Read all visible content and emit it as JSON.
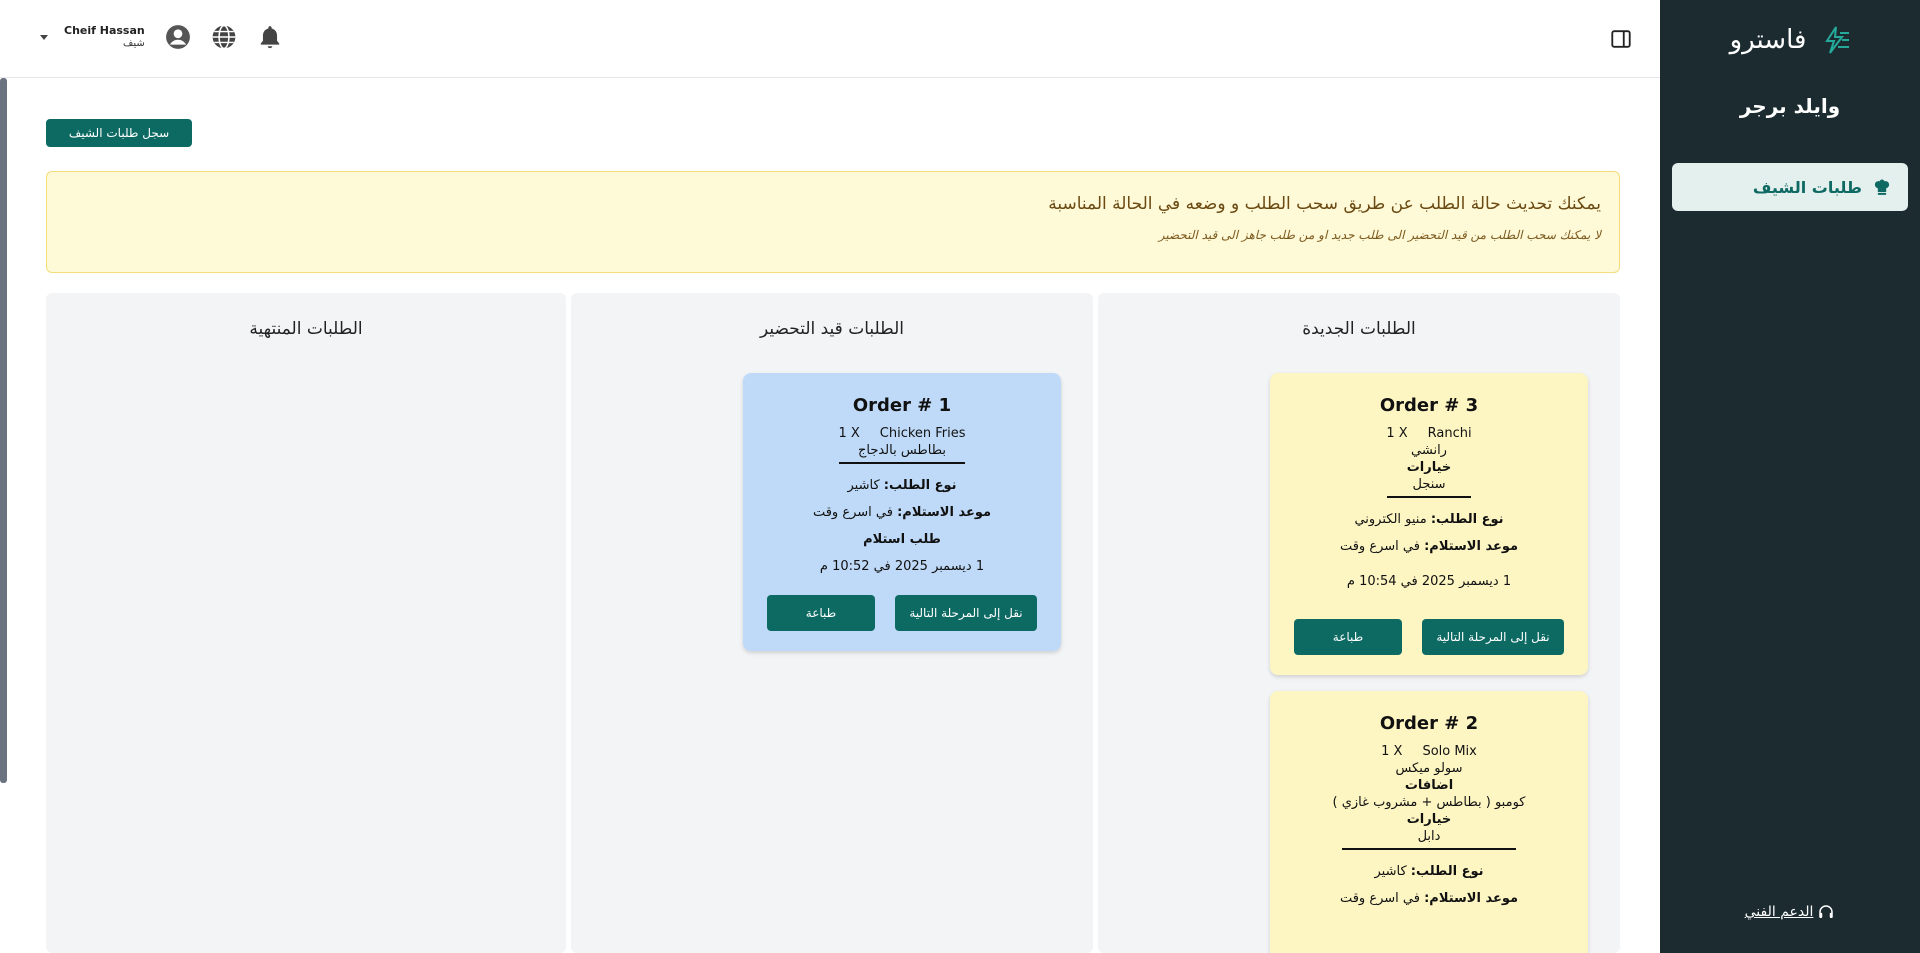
{
  "sidebar": {
    "brand": "فاسترو",
    "restaurant": "وايلد برجر",
    "nav_item": "طلبات الشيف",
    "support": "الدعم الفني"
  },
  "header": {
    "user_name": "Cheif Hassan",
    "user_role": "شيف"
  },
  "toolbar": {
    "history_button": "سجل طلبات الشيف"
  },
  "notice": {
    "title": "يمكنك تحديث حالة الطلب عن طريق سحب الطلب و وضعه في الحالة المناسبة",
    "subtitle": "لا يمكنك سحب الطلب من قيد التحضير الى طلب جديد او من طلب جاهز الى قيد التحضير"
  },
  "columns": {
    "new": "الطلبات الجديدة",
    "prep": "الطلبات قيد التحضير",
    "done": "الطلبات المنتهية"
  },
  "labels": {
    "order_type": "نوع الطلب:",
    "pickup_time": "موعد الاستلام:",
    "options": "خيارات",
    "addons": "اضافات",
    "next_stage": "نقل إلى المرحلة التالية",
    "print": "طباعة"
  },
  "orders": {
    "o3": {
      "title": "Order # 3",
      "qty": "1 X",
      "item_en": "Ranchi",
      "item_ar": "رانشي",
      "option": "سنجل",
      "type": "منيو الكتروني",
      "pickup": "في اسرع وقت",
      "date": "1 ديسمبر 2025 في 10:54 م"
    },
    "o2": {
      "title": "Order # 2",
      "qty": "1 X",
      "item_en": "Solo Mix",
      "item_ar": "سولو ميكس",
      "addon": "كومبو ( بطاطس + مشروب غازي )",
      "option": "دابل",
      "type": "كاشير",
      "pickup": "في اسرع وقت"
    },
    "o1": {
      "title": "Order # 1",
      "qty": "1 X",
      "item_en": "Chicken Fries",
      "item_ar": "بطاطس بالدجاج",
      "type": "كاشير",
      "pickup": "في اسرع وقت",
      "kind": "طلب استلام",
      "date": "1 ديسمبر 2025 في 10:52 م"
    }
  }
}
